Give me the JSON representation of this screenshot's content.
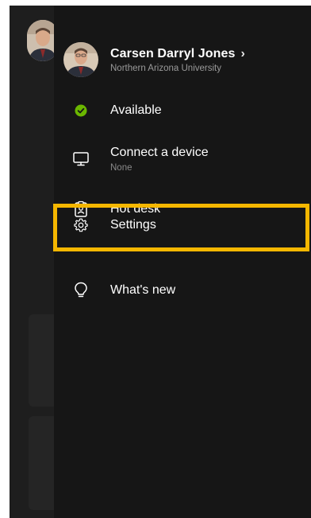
{
  "profile": {
    "name": "Carsen Darryl Jones",
    "chevron": "›",
    "organization": "Northern Arizona University",
    "avatar_icon": "profile-photo"
  },
  "menu": {
    "available": {
      "label": "Available",
      "icon": "check-circle-icon",
      "status_color": "#6bb700"
    },
    "connect": {
      "label": "Connect a device",
      "sub": "None",
      "icon": "monitor-icon"
    },
    "hotdesk": {
      "label": "Hot desk",
      "icon": "clipboard-person-icon"
    },
    "settings": {
      "label": "Settings",
      "icon": "gear-icon"
    },
    "whatsnew": {
      "label": "What's new",
      "icon": "lightbulb-icon"
    }
  },
  "colors": {
    "highlight": "#f5b700",
    "drawer_bg": "#161616",
    "available": "#6bb700"
  }
}
